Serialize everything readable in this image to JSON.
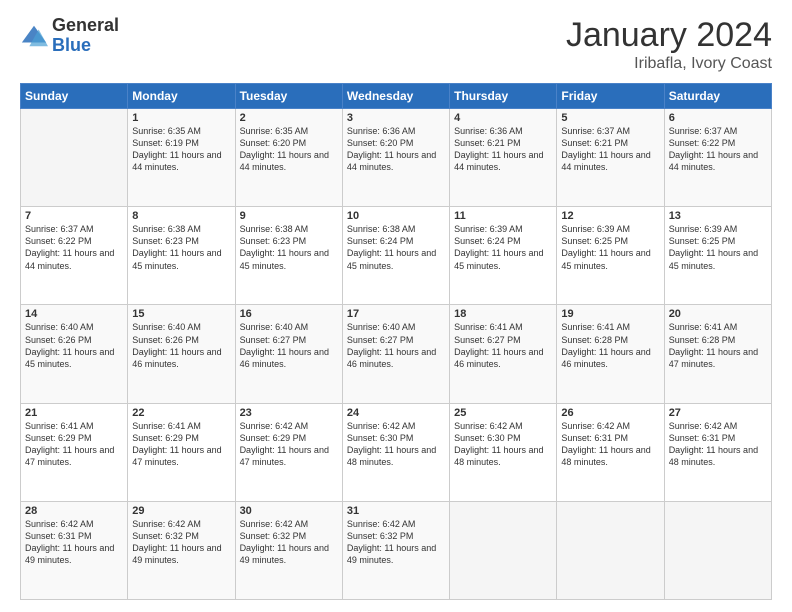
{
  "logo": {
    "general": "General",
    "blue": "Blue"
  },
  "title": "January 2024",
  "location": "Iribafla, Ivory Coast",
  "days_header": [
    "Sunday",
    "Monday",
    "Tuesday",
    "Wednesday",
    "Thursday",
    "Friday",
    "Saturday"
  ],
  "weeks": [
    [
      {
        "day": "",
        "sunrise": "",
        "sunset": "",
        "daylight": ""
      },
      {
        "day": "1",
        "sunrise": "Sunrise: 6:35 AM",
        "sunset": "Sunset: 6:19 PM",
        "daylight": "Daylight: 11 hours and 44 minutes."
      },
      {
        "day": "2",
        "sunrise": "Sunrise: 6:35 AM",
        "sunset": "Sunset: 6:20 PM",
        "daylight": "Daylight: 11 hours and 44 minutes."
      },
      {
        "day": "3",
        "sunrise": "Sunrise: 6:36 AM",
        "sunset": "Sunset: 6:20 PM",
        "daylight": "Daylight: 11 hours and 44 minutes."
      },
      {
        "day": "4",
        "sunrise": "Sunrise: 6:36 AM",
        "sunset": "Sunset: 6:21 PM",
        "daylight": "Daylight: 11 hours and 44 minutes."
      },
      {
        "day": "5",
        "sunrise": "Sunrise: 6:37 AM",
        "sunset": "Sunset: 6:21 PM",
        "daylight": "Daylight: 11 hours and 44 minutes."
      },
      {
        "day": "6",
        "sunrise": "Sunrise: 6:37 AM",
        "sunset": "Sunset: 6:22 PM",
        "daylight": "Daylight: 11 hours and 44 minutes."
      }
    ],
    [
      {
        "day": "7",
        "sunrise": "Sunrise: 6:37 AM",
        "sunset": "Sunset: 6:22 PM",
        "daylight": "Daylight: 11 hours and 44 minutes."
      },
      {
        "day": "8",
        "sunrise": "Sunrise: 6:38 AM",
        "sunset": "Sunset: 6:23 PM",
        "daylight": "Daylight: 11 hours and 45 minutes."
      },
      {
        "day": "9",
        "sunrise": "Sunrise: 6:38 AM",
        "sunset": "Sunset: 6:23 PM",
        "daylight": "Daylight: 11 hours and 45 minutes."
      },
      {
        "day": "10",
        "sunrise": "Sunrise: 6:38 AM",
        "sunset": "Sunset: 6:24 PM",
        "daylight": "Daylight: 11 hours and 45 minutes."
      },
      {
        "day": "11",
        "sunrise": "Sunrise: 6:39 AM",
        "sunset": "Sunset: 6:24 PM",
        "daylight": "Daylight: 11 hours and 45 minutes."
      },
      {
        "day": "12",
        "sunrise": "Sunrise: 6:39 AM",
        "sunset": "Sunset: 6:25 PM",
        "daylight": "Daylight: 11 hours and 45 minutes."
      },
      {
        "day": "13",
        "sunrise": "Sunrise: 6:39 AM",
        "sunset": "Sunset: 6:25 PM",
        "daylight": "Daylight: 11 hours and 45 minutes."
      }
    ],
    [
      {
        "day": "14",
        "sunrise": "Sunrise: 6:40 AM",
        "sunset": "Sunset: 6:26 PM",
        "daylight": "Daylight: 11 hours and 45 minutes."
      },
      {
        "day": "15",
        "sunrise": "Sunrise: 6:40 AM",
        "sunset": "Sunset: 6:26 PM",
        "daylight": "Daylight: 11 hours and 46 minutes."
      },
      {
        "day": "16",
        "sunrise": "Sunrise: 6:40 AM",
        "sunset": "Sunset: 6:27 PM",
        "daylight": "Daylight: 11 hours and 46 minutes."
      },
      {
        "day": "17",
        "sunrise": "Sunrise: 6:40 AM",
        "sunset": "Sunset: 6:27 PM",
        "daylight": "Daylight: 11 hours and 46 minutes."
      },
      {
        "day": "18",
        "sunrise": "Sunrise: 6:41 AM",
        "sunset": "Sunset: 6:27 PM",
        "daylight": "Daylight: 11 hours and 46 minutes."
      },
      {
        "day": "19",
        "sunrise": "Sunrise: 6:41 AM",
        "sunset": "Sunset: 6:28 PM",
        "daylight": "Daylight: 11 hours and 46 minutes."
      },
      {
        "day": "20",
        "sunrise": "Sunrise: 6:41 AM",
        "sunset": "Sunset: 6:28 PM",
        "daylight": "Daylight: 11 hours and 47 minutes."
      }
    ],
    [
      {
        "day": "21",
        "sunrise": "Sunrise: 6:41 AM",
        "sunset": "Sunset: 6:29 PM",
        "daylight": "Daylight: 11 hours and 47 minutes."
      },
      {
        "day": "22",
        "sunrise": "Sunrise: 6:41 AM",
        "sunset": "Sunset: 6:29 PM",
        "daylight": "Daylight: 11 hours and 47 minutes."
      },
      {
        "day": "23",
        "sunrise": "Sunrise: 6:42 AM",
        "sunset": "Sunset: 6:29 PM",
        "daylight": "Daylight: 11 hours and 47 minutes."
      },
      {
        "day": "24",
        "sunrise": "Sunrise: 6:42 AM",
        "sunset": "Sunset: 6:30 PM",
        "daylight": "Daylight: 11 hours and 48 minutes."
      },
      {
        "day": "25",
        "sunrise": "Sunrise: 6:42 AM",
        "sunset": "Sunset: 6:30 PM",
        "daylight": "Daylight: 11 hours and 48 minutes."
      },
      {
        "day": "26",
        "sunrise": "Sunrise: 6:42 AM",
        "sunset": "Sunset: 6:31 PM",
        "daylight": "Daylight: 11 hours and 48 minutes."
      },
      {
        "day": "27",
        "sunrise": "Sunrise: 6:42 AM",
        "sunset": "Sunset: 6:31 PM",
        "daylight": "Daylight: 11 hours and 48 minutes."
      }
    ],
    [
      {
        "day": "28",
        "sunrise": "Sunrise: 6:42 AM",
        "sunset": "Sunset: 6:31 PM",
        "daylight": "Daylight: 11 hours and 49 minutes."
      },
      {
        "day": "29",
        "sunrise": "Sunrise: 6:42 AM",
        "sunset": "Sunset: 6:32 PM",
        "daylight": "Daylight: 11 hours and 49 minutes."
      },
      {
        "day": "30",
        "sunrise": "Sunrise: 6:42 AM",
        "sunset": "Sunset: 6:32 PM",
        "daylight": "Daylight: 11 hours and 49 minutes."
      },
      {
        "day": "31",
        "sunrise": "Sunrise: 6:42 AM",
        "sunset": "Sunset: 6:32 PM",
        "daylight": "Daylight: 11 hours and 49 minutes."
      },
      {
        "day": "",
        "sunrise": "",
        "sunset": "",
        "daylight": ""
      },
      {
        "day": "",
        "sunrise": "",
        "sunset": "",
        "daylight": ""
      },
      {
        "day": "",
        "sunrise": "",
        "sunset": "",
        "daylight": ""
      }
    ]
  ]
}
